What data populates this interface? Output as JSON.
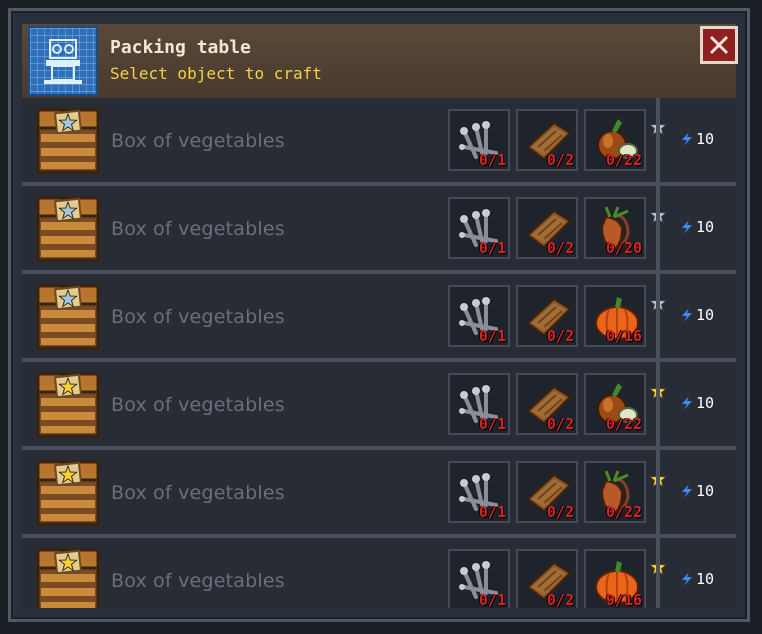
{
  "header": {
    "title": "Packing table",
    "subtitle": "Select object to craft",
    "icon": "blueprint-icon",
    "close_icon": "close-icon"
  },
  "colors": {
    "count_red": "#d82525",
    "subtitle_yellow": "#f2d34a",
    "silver_star": "#a9c6d8",
    "gold_star": "#f5d22a"
  },
  "recipes": [
    {
      "name": "Box of vegetables",
      "quality": "silver",
      "ingredients": [
        {
          "icon": "nails-icon",
          "count": "0/1"
        },
        {
          "icon": "plank-icon",
          "count": "0/2"
        },
        {
          "icon": "onion-icon",
          "count": "0/22",
          "star": "silver"
        }
      ],
      "energy": "10"
    },
    {
      "name": "Box of vegetables",
      "quality": "silver",
      "ingredients": [
        {
          "icon": "nails-icon",
          "count": "0/1"
        },
        {
          "icon": "plank-icon",
          "count": "0/2"
        },
        {
          "icon": "carrot-icon",
          "count": "0/20",
          "star": "silver"
        }
      ],
      "energy": "10"
    },
    {
      "name": "Box of vegetables",
      "quality": "silver",
      "ingredients": [
        {
          "icon": "nails-icon",
          "count": "0/1"
        },
        {
          "icon": "plank-icon",
          "count": "0/2"
        },
        {
          "icon": "pumpkin-icon",
          "count": "0/16",
          "star": "silver"
        }
      ],
      "energy": "10"
    },
    {
      "name": "Box of vegetables",
      "quality": "gold",
      "ingredients": [
        {
          "icon": "nails-icon",
          "count": "0/1"
        },
        {
          "icon": "plank-icon",
          "count": "0/2"
        },
        {
          "icon": "onion-icon",
          "count": "0/22",
          "star": "gold"
        }
      ],
      "energy": "10"
    },
    {
      "name": "Box of vegetables",
      "quality": "gold",
      "ingredients": [
        {
          "icon": "nails-icon",
          "count": "0/1"
        },
        {
          "icon": "plank-icon",
          "count": "0/2"
        },
        {
          "icon": "carrot-icon",
          "count": "0/22",
          "star": "gold"
        }
      ],
      "energy": "10"
    },
    {
      "name": "Box of vegetables",
      "quality": "gold",
      "ingredients": [
        {
          "icon": "nails-icon",
          "count": "0/1"
        },
        {
          "icon": "plank-icon",
          "count": "0/2"
        },
        {
          "icon": "pumpkin-icon",
          "count": "9/16",
          "star": "gold"
        }
      ],
      "energy": "10"
    }
  ]
}
